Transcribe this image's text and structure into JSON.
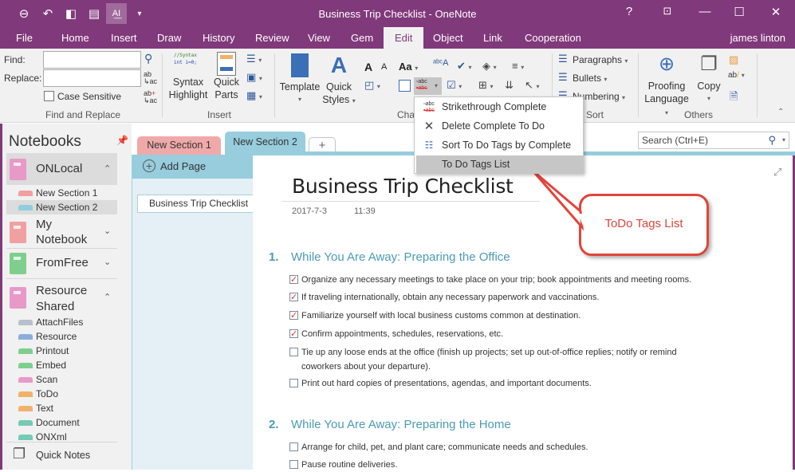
{
  "window": {
    "title": "Business Trip Checklist - OneNote",
    "quick_access": [
      {
        "name": "back-icon",
        "glyph": "⊖"
      },
      {
        "name": "undo-icon",
        "glyph": "↶"
      },
      {
        "name": "dock-icon",
        "glyph": "▮"
      },
      {
        "name": "fullpage-icon",
        "glyph": "▤"
      },
      {
        "name": "touch-mode-icon",
        "glyph": "A"
      },
      {
        "name": "customize-icon",
        "glyph": "▾"
      }
    ],
    "controls": {
      "help": "?",
      "ribbon_display": "⊡",
      "minimize": "—",
      "maximize": "☐",
      "close": "✕"
    }
  },
  "menu_tabs": [
    "File",
    "Home",
    "Insert",
    "Draw",
    "History",
    "Review",
    "View",
    "Gem",
    "Edit",
    "Object",
    "Link",
    "Cooperation"
  ],
  "selected_tab": "Edit",
  "user": "james linton",
  "ribbon": {
    "find_replace": {
      "find_label": "Find:",
      "replace_label": "Replace:",
      "find_value": "",
      "replace_value": "",
      "case_sensitive_label": "Case Sensitive",
      "case_sensitive_checked": false,
      "group_label": "Find and Replace"
    },
    "insert": {
      "syntax_highlight": "Syntax Highlight",
      "syntax_line1": "Syntax",
      "syntax_line2": "Highlight",
      "syntax_preview_1": "//Syntax",
      "syntax_preview_2": "int i=0;",
      "quick_parts_1": "Quick",
      "quick_parts_2": "Parts",
      "group_label": "Insert"
    },
    "template": "Template",
    "quick_styles_1": "Quick",
    "quick_styles_2": "Styles",
    "char_group_label": "Char",
    "sort": {
      "paragraphs": "Paragraphs",
      "bullets": "Bullets",
      "numbering": "Numbering",
      "group_label": "Sort"
    },
    "others": {
      "proofing_1": "Proofing",
      "proofing_2": "Language",
      "copy": "Copy",
      "group_label": "Others"
    }
  },
  "dropdown_menu": {
    "items": [
      {
        "label": "Strikethrough Complete",
        "icon": "strikethrough-complete-icon",
        "glyph": "▫"
      },
      {
        "label": "Delete Complete To Do",
        "icon": "delete-icon",
        "glyph": "✕"
      },
      {
        "label": "Sort To Do Tags by Complete",
        "icon": "sort-list-icon",
        "glyph": "☰"
      },
      {
        "label": "To Do Tags List",
        "icon": "",
        "glyph": ""
      }
    ],
    "highlighted": "To Do Tags List"
  },
  "sidebar": {
    "title": "Notebooks",
    "notebooks": [
      {
        "name": "ONLocal",
        "color": "#e899c8",
        "expanded": true,
        "sections": [
          {
            "name": "New Section 1",
            "color": "#f0a0a0"
          },
          {
            "name": "New Section 2",
            "color": "#8fcde0"
          }
        ]
      },
      {
        "name_1": "My",
        "name_2": "Notebook",
        "color": "#f0a0a0",
        "expanded": false
      },
      {
        "name": "FromFree",
        "color": "#7ecf8e",
        "expanded": false
      },
      {
        "name_1": "Resource",
        "name_2": "Shared",
        "color": "#e899c8",
        "expanded": true,
        "sections": [
          {
            "name": "AttachFiles",
            "color": "#b7c0cc"
          },
          {
            "name": "Resource",
            "color": "#8aaedc"
          },
          {
            "name": "Printout",
            "color": "#7ecf8e"
          },
          {
            "name": "Embed",
            "color": "#7ecf8e"
          },
          {
            "name": "Scan",
            "color": "#e899c8"
          },
          {
            "name": "ToDo",
            "color": "#f2b16a"
          },
          {
            "name": "Text",
            "color": "#f2b16a"
          },
          {
            "name": "Document",
            "color": "#74cab5"
          },
          {
            "name": "ONXml",
            "color": "#74cab5"
          }
        ]
      }
    ],
    "quick_notes": "Quick Notes"
  },
  "section_tabs": [
    {
      "label": "New Section 1",
      "color": "#f0a9a9"
    },
    {
      "label": "New Section 2",
      "color": "#97cddd"
    },
    {
      "label": "+",
      "color": "#fff"
    }
  ],
  "search_placeholder": "Search (Ctrl+E)",
  "page_pane": {
    "add_page": "Add Page",
    "pages": [
      "Business Trip Checklist"
    ]
  },
  "page": {
    "title": "Business Trip Checklist",
    "date": "2017-7-3",
    "time": "11:39",
    "sections": [
      {
        "num": "1.",
        "heading": "While You Are Away: Preparing the Office",
        "items": [
          {
            "text": "Organize any necessary meetings to take place on your trip; book appointments and meeting rooms.",
            "checked": true
          },
          {
            "text": "If traveling internationally, obtain any necessary paperwork and vaccinations.",
            "checked": true
          },
          {
            "text": "Familiarize yourself with local business customs common at destination.",
            "checked": true
          },
          {
            "text": "Confirm appointments, schedules, reservations, etc.",
            "checked": true
          },
          {
            "text": "Tie up any loose ends at the office (finish up projects; set up out-of-office replies; notify or remind coworkers about your departure).",
            "checked": false
          },
          {
            "text": "Print out hard copies of presentations, agendas, and important documents.",
            "checked": false
          }
        ]
      },
      {
        "num": "2.",
        "heading": "While You Are Away: Preparing the Home",
        "items": [
          {
            "text": "Arrange for child, pet, and plant care; communicate needs and schedules.",
            "checked": false
          },
          {
            "text": "Pause routine deliveries.",
            "checked": false
          }
        ]
      }
    ]
  },
  "callout": {
    "text": "ToDo Tags List",
    "color": "#e0453b"
  }
}
